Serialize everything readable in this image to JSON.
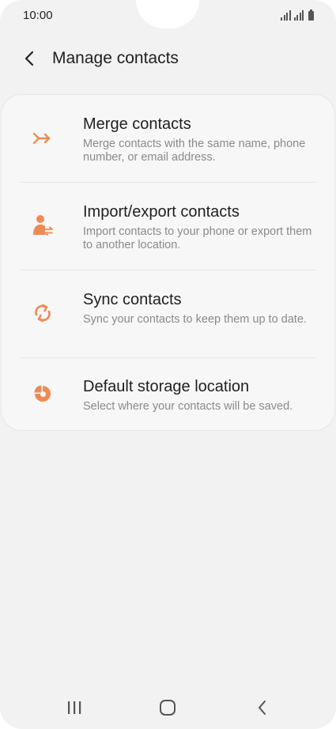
{
  "status_bar": {
    "time": "10:00"
  },
  "header": {
    "title": "Manage contacts",
    "back_icon": "chevron-left-icon"
  },
  "colors": {
    "accent": "#ef8a55",
    "background": "#f2f2f2",
    "card": "#f7f7f7",
    "title_text": "#1f1f1f",
    "secondary_text": "#8a8a8a"
  },
  "menu": {
    "items": [
      {
        "icon": "merge-arrows-icon",
        "title": "Merge contacts",
        "description": "Merge contacts with the same name, phone number, or email address."
      },
      {
        "icon": "person-transfer-icon",
        "title": "Import/export contacts",
        "description": "Import contacts to your phone or export them to another location."
      },
      {
        "icon": "sync-icon",
        "title": "Sync contacts",
        "description": "Sync your contacts to keep them up to date."
      },
      {
        "icon": "storage-pie-icon",
        "title": "Default storage location",
        "description": "Select where your contacts will be saved."
      }
    ]
  },
  "nav_bar": {
    "recents_icon": "recents-icon",
    "home_icon": "home-icon",
    "back_icon": "back-icon"
  }
}
